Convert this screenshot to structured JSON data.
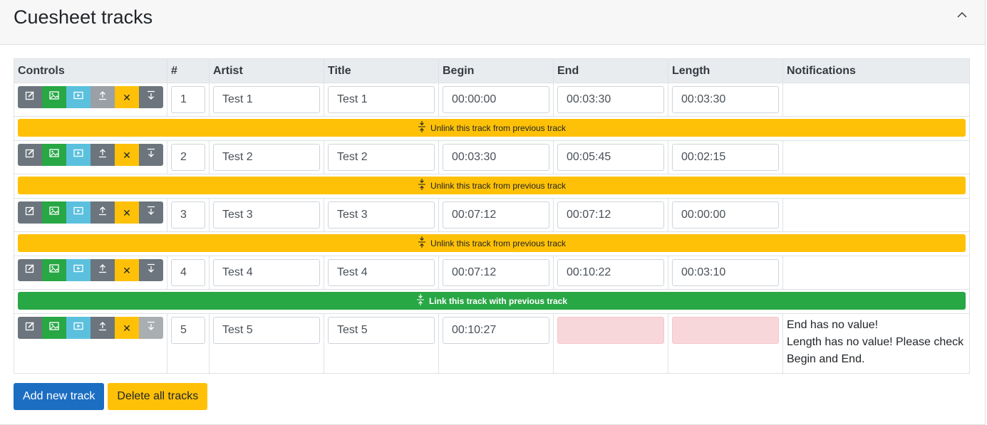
{
  "header": {
    "title": "Cuesheet tracks"
  },
  "table": {
    "columns": [
      "Controls",
      "#",
      "Artist",
      "Title",
      "Begin",
      "End",
      "Length",
      "Notifications"
    ],
    "tracks": [
      {
        "number": "1",
        "artist": "Test 1",
        "title": "Test 1",
        "begin": "00:00:00",
        "end": "00:03:30",
        "length": "00:03:30",
        "notifications": []
      },
      {
        "number": "2",
        "artist": "Test 2",
        "title": "Test 2",
        "begin": "00:03:30",
        "end": "00:05:45",
        "length": "00:02:15",
        "notifications": []
      },
      {
        "number": "3",
        "artist": "Test 3",
        "title": "Test 3",
        "begin": "00:07:12",
        "end": "00:07:12",
        "length": "00:00:00",
        "notifications": []
      },
      {
        "number": "4",
        "artist": "Test 4",
        "title": "Test 4",
        "begin": "00:07:12",
        "end": "00:10:22",
        "length": "00:03:10",
        "notifications": []
      },
      {
        "number": "5",
        "artist": "Test 5",
        "title": "Test 5",
        "begin": "00:10:27",
        "end": "",
        "length": "",
        "notifications": [
          "End has no value!",
          "Length has no value! Please check Begin and End."
        ]
      }
    ],
    "link_bars": [
      {
        "label": "Unlink this track from previous track",
        "kind": "unlink"
      },
      {
        "label": "Unlink this track from previous track",
        "kind": "unlink"
      },
      {
        "label": "Unlink this track from previous track",
        "kind": "unlink"
      },
      {
        "label": "Link this track with previous track",
        "kind": "link"
      }
    ]
  },
  "buttons": {
    "add": "Add new track",
    "delete_all": "Delete all tracks"
  },
  "colors": {
    "primary": "#1b6ec2",
    "warning": "#ffc107",
    "success": "#28a745",
    "info": "#5bc0de",
    "secondary": "#6c757d",
    "invalid": "#f8d7da"
  },
  "icons": [
    "chevron-up-icon",
    "edit-icon",
    "image-icon",
    "play-icon",
    "move-up-icon",
    "delete-icon",
    "move-down-icon",
    "link-arrows-icon"
  ]
}
